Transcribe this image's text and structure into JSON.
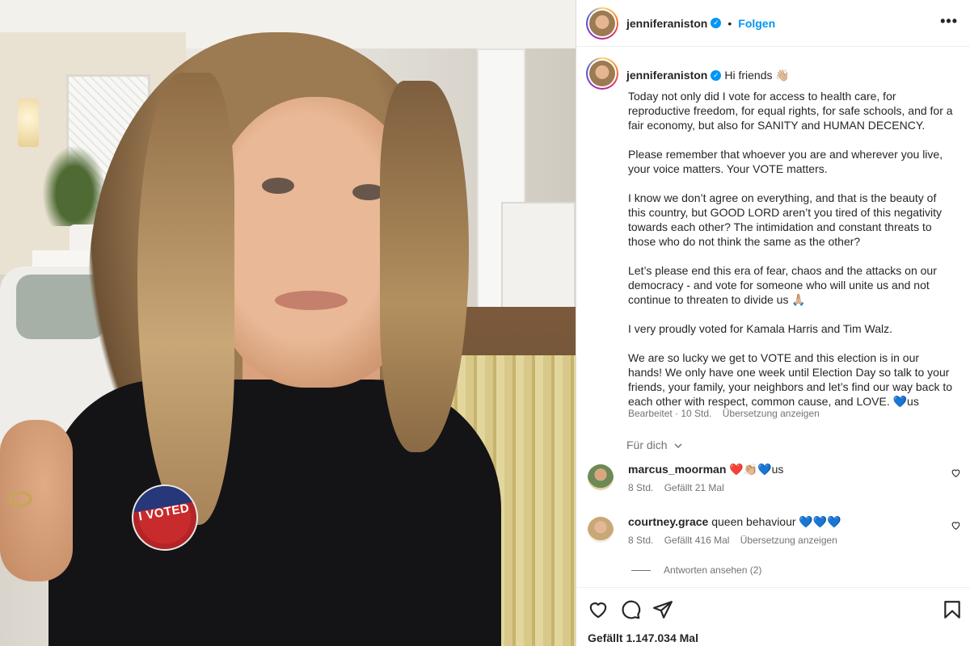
{
  "post": {
    "username": "jenniferaniston",
    "follow_label": "Folgen",
    "more_label": "•••"
  },
  "caption": {
    "username": "jenniferaniston",
    "intro": "Hi friends 👋🏼",
    "paragraphs": [
      "Today not only did I vote for access to health care, for reproductive freedom, for equal rights, for safe schools, and for a fair economy, but also for SANITY and HUMAN DECENCY.",
      "Please remember that whoever you are and wherever you live, your voice matters. Your VOTE matters.",
      "I know we don’t agree on everything, and that is the beauty of this country, but GOOD LORD aren’t you tired of this negativity towards each other? The intimidation and constant threats to those who do not think the same as the other?",
      "Let’s please end this era of fear, chaos and the attacks on our democracy - and vote for someone who will unite us and not continue to threaten to divide us 🙏🏼",
      "I very proudly voted for Kamala Harris and Tim Walz.",
      "We are so lucky we get to VOTE and this election is in our hands! We only have one week until Election Day so talk to your friends, your family, your neighbors and let’s find our way back to each other with respect, common cause, and LOVE. 💙us"
    ],
    "edited": "Bearbeitet · 10 Std.",
    "see_translation": "Übersetzung anzeigen"
  },
  "fuer_dich": "Für dich",
  "comments": [
    {
      "username": "marcus_moorman",
      "text": "❤️👏🏼💙us",
      "time": "8 Std.",
      "likes": "Gefällt 21 Mal",
      "translate": ""
    },
    {
      "username": "courtney.grace",
      "text": "queen behaviour 💙💙💙",
      "time": "8 Std.",
      "likes": "Gefällt 416 Mal",
      "translate": "Übersetzung anzeigen"
    }
  ],
  "view_replies": "Antworten ansehen (2)",
  "likes_total": "Gefällt 1.147.034 Mal",
  "photo": {
    "sticker_text": "I VOTED"
  },
  "colors": {
    "accent": "#0095f6",
    "text": "#262626",
    "muted": "#737373"
  },
  "icons": [
    "heart-icon",
    "comment-icon",
    "share-icon",
    "bookmark-icon",
    "verified-badge-icon",
    "more-options-icon",
    "chevron-down-icon"
  ]
}
